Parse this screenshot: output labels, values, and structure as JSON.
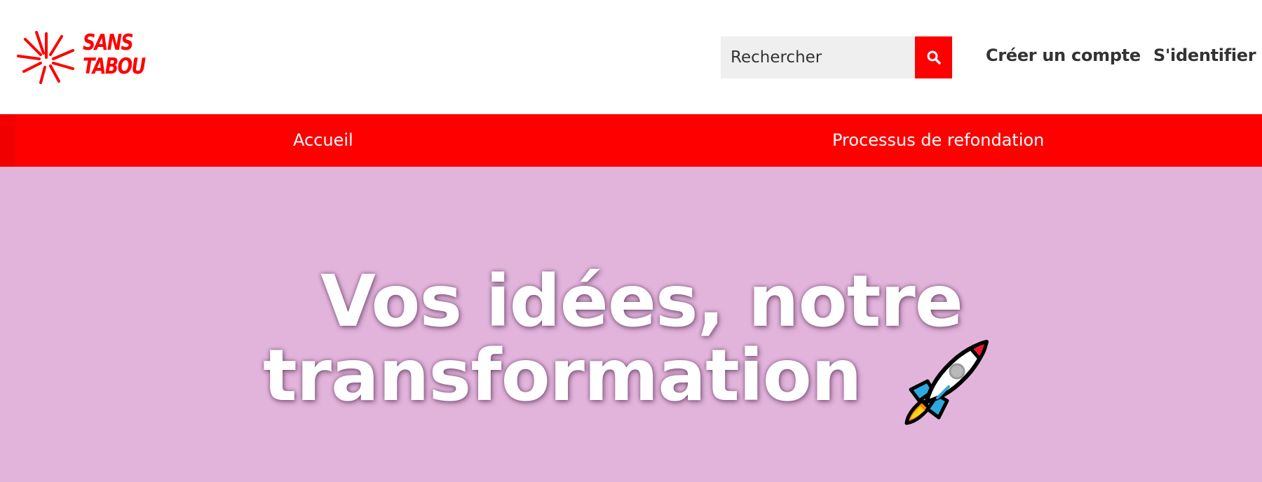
{
  "header": {
    "logo": {
      "line1": "SANS",
      "line2": "TABOU"
    },
    "search": {
      "placeholder": "Rechercher",
      "button_icon": "search-icon"
    },
    "auth": {
      "create_account": "Créer un compte",
      "sign_in": "S'identifier"
    }
  },
  "nav": {
    "items": [
      {
        "label": "Accueil"
      },
      {
        "label": "Processus de refondation"
      }
    ]
  },
  "hero": {
    "title_line1": "Vos idées, notre",
    "title_line2": "transformation",
    "emoji_icon": "rocket-icon"
  },
  "colors": {
    "brand_red": "#ff0000",
    "hero_background": "#e2b4db",
    "text_dark": "#333333"
  }
}
